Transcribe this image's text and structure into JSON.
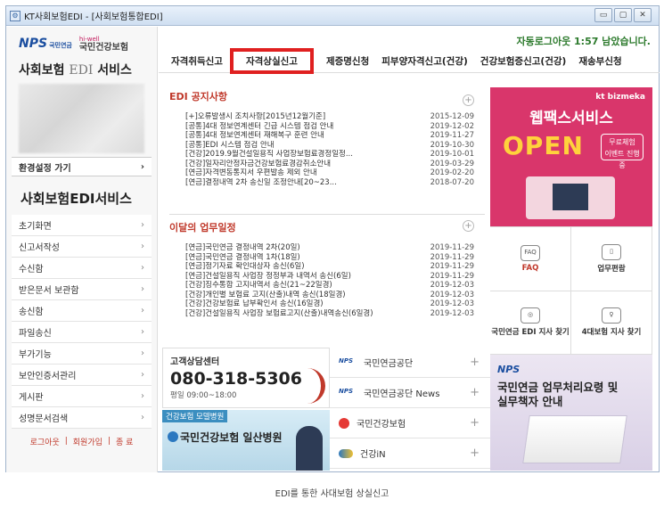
{
  "window": {
    "title": "KT사회보험EDI - [사회보험통합EDI]",
    "buttons": [
      "▭",
      "▢",
      "✕"
    ]
  },
  "sidebar": {
    "nps_logo": "NPS",
    "nps_logo_sub": "국민연금",
    "nhis_logo_top": "hi-well",
    "nhis_logo": "국민건강보험",
    "service_title_left": "사회보험 ",
    "service_title_edi": "EDI",
    "service_title_right": " 서비스",
    "env_label": "환경설정 가기",
    "edi_head": "사회보험EDI서비스",
    "menu": [
      {
        "label": "초기화면"
      },
      {
        "label": "신고서작성"
      },
      {
        "label": "수신함"
      },
      {
        "label": "받은문서 보관함"
      },
      {
        "label": "송신함"
      },
      {
        "label": "파일송신"
      },
      {
        "label": "부가기능"
      },
      {
        "label": "보안인증서관리"
      },
      {
        "label": "게시판"
      },
      {
        "label": "성명문서검색"
      }
    ],
    "bottom": {
      "logout": "로그아웃",
      "member": "회원가입",
      "end": "종 료"
    }
  },
  "main": {
    "autologout": "자동로그아웃 1:57 남았습니다.",
    "tabs": [
      "자격취득신고",
      "자격상실신고",
      "제증명신청",
      "피부양자격신고(건강)",
      "건강보험증신고(건강)",
      "재송부신청"
    ],
    "notices": {
      "title": "EDI 공지사항",
      "items": [
        {
          "t": "[+]오류발생시 조치사항[2015년12월기준]",
          "d": "2015-12-09"
        },
        {
          "t": "[공통]4대 정보연계센터 긴급 시스템 점검 안내",
          "d": "2019-12-02"
        },
        {
          "t": "[공통]4대 정보연계센터 재해복구 훈련 안내",
          "d": "2019-11-27"
        },
        {
          "t": "[공통]EDI 시스템 점검 안내",
          "d": "2019-10-30"
        },
        {
          "t": "[건강]2019.9월건설일용직 사업장보험료경정일정...",
          "d": "2019-10-01"
        },
        {
          "t": "[건강]일자리안정자금건강보험료경감취소안내",
          "d": "2019-03-29"
        },
        {
          "t": "[연금]자격변동통지서 우편발송 제외 안내",
          "d": "2019-02-20"
        },
        {
          "t": "[연금]결정내역 2차 송신일 조정안내[20~23...",
          "d": "2018-07-20"
        }
      ]
    },
    "schedule": {
      "title": "이달의 업무일정",
      "items": [
        {
          "t": "[연금]국민연금 결정내역 2차(20일)",
          "d": "2019-11-29"
        },
        {
          "t": "[연금]국민연금 결정내역 1차(18일)",
          "d": "2019-11-29"
        },
        {
          "t": "[연금]정기자료 확인대상자 송신(6일)",
          "d": "2019-11-29"
        },
        {
          "t": "[연금]건설일용직 사업장 정정부과 내역서 송신(6일)",
          "d": "2019-11-29"
        },
        {
          "t": "[건강]징수통합 고지내역서 송신(21~22일경)",
          "d": "2019-12-03"
        },
        {
          "t": "[건강]개인별 보험료 고지(산출)내역 송신(18일경)",
          "d": "2019-12-03"
        },
        {
          "t": "[건강]건강보험료 납부확인서 송신(16일경)",
          "d": "2019-12-03"
        },
        {
          "t": "[건강]건설일용직 사업장 보험료고지(산출)내역송신(6일경)",
          "d": "2019-12-03"
        }
      ]
    },
    "ad": {
      "brand": "kt bizmeka",
      "line1": "웹팩스서비스",
      "line2": "OPEN",
      "badge1": "무료체험",
      "badge2": "이벤트 진행중"
    },
    "quick": [
      {
        "icon": "FAQ",
        "label": "FAQ"
      },
      {
        "icon": "▯",
        "label": "업무편람"
      },
      {
        "icon": "◎",
        "label": "국민연금 EDI 지사 찾기"
      },
      {
        "icon": "♀",
        "label": "4대보험 지사 찾기"
      }
    ],
    "callcenter": {
      "cap": "고객상담센터",
      "phone": "080-318-5306",
      "hours": "평일 09:00~18:00"
    },
    "hospital": {
      "cap": "건강보험 모델병원",
      "name": "국민건강보험 일산병원"
    },
    "links": [
      {
        "logo": "NPS",
        "label": "국민연금공단"
      },
      {
        "logo": "NPS",
        "label": "국민연금공단 News"
      },
      {
        "logo": "",
        "label": "국민건강보험"
      },
      {
        "logo": "",
        "label": "건강iN"
      }
    ],
    "manual": {
      "logo": "NPS",
      "line1": "국민연금 업무처리요령 및",
      "line2": "실무책자 안내"
    }
  },
  "caption": "EDI를 통한 사대보험 상실신고",
  "colors": {
    "highlight": "#e02020",
    "accent": "#c0392b",
    "ad": "#d9366b"
  }
}
